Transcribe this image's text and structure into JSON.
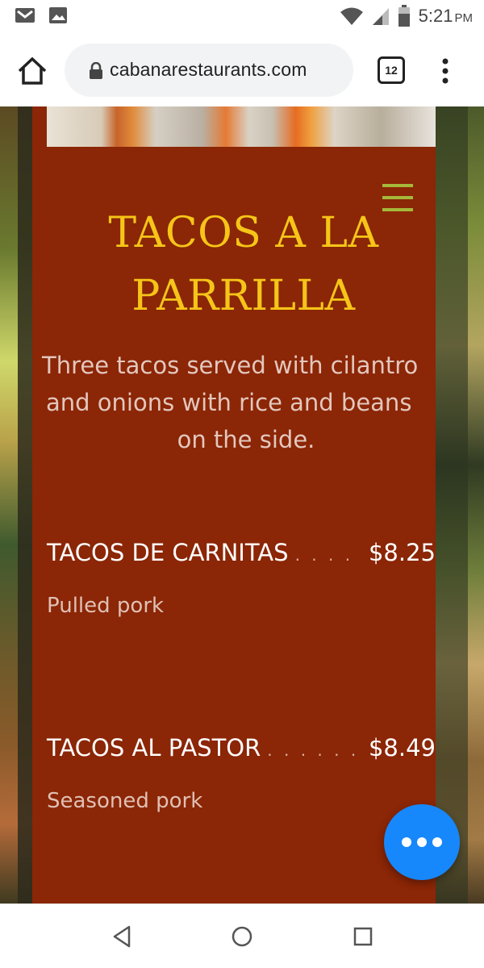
{
  "status_bar": {
    "time": "5:21",
    "ampm": "PM",
    "icons": [
      "gmail-icon",
      "image-icon",
      "wifi-icon",
      "signal-icon",
      "battery-icon"
    ]
  },
  "browser": {
    "url": "cabanarestaurants.com",
    "tab_count": "12"
  },
  "menu_section": {
    "title_line1": "TACOS A LA",
    "title_line2": "PARRILLA",
    "description_line1": "Three tacos served with cilantro",
    "description_line2": "and onions with rice and beans",
    "description_line3": "on the side.",
    "items": [
      {
        "name": "TACOS DE CARNITAS",
        "dots": ". . . . . . . . . . .",
        "price": "$8.25",
        "description": "Pulled pork"
      },
      {
        "name": "TACOS AL PASTOR",
        "dots": ". . . . . . . . . . . . . .",
        "price": "$8.49",
        "description": "Seasoned pork"
      }
    ]
  },
  "colors": {
    "panel_bg": "#8b2606",
    "title": "#f5c518",
    "fab": "#1788fb",
    "hamburger": "#a5b83a"
  }
}
